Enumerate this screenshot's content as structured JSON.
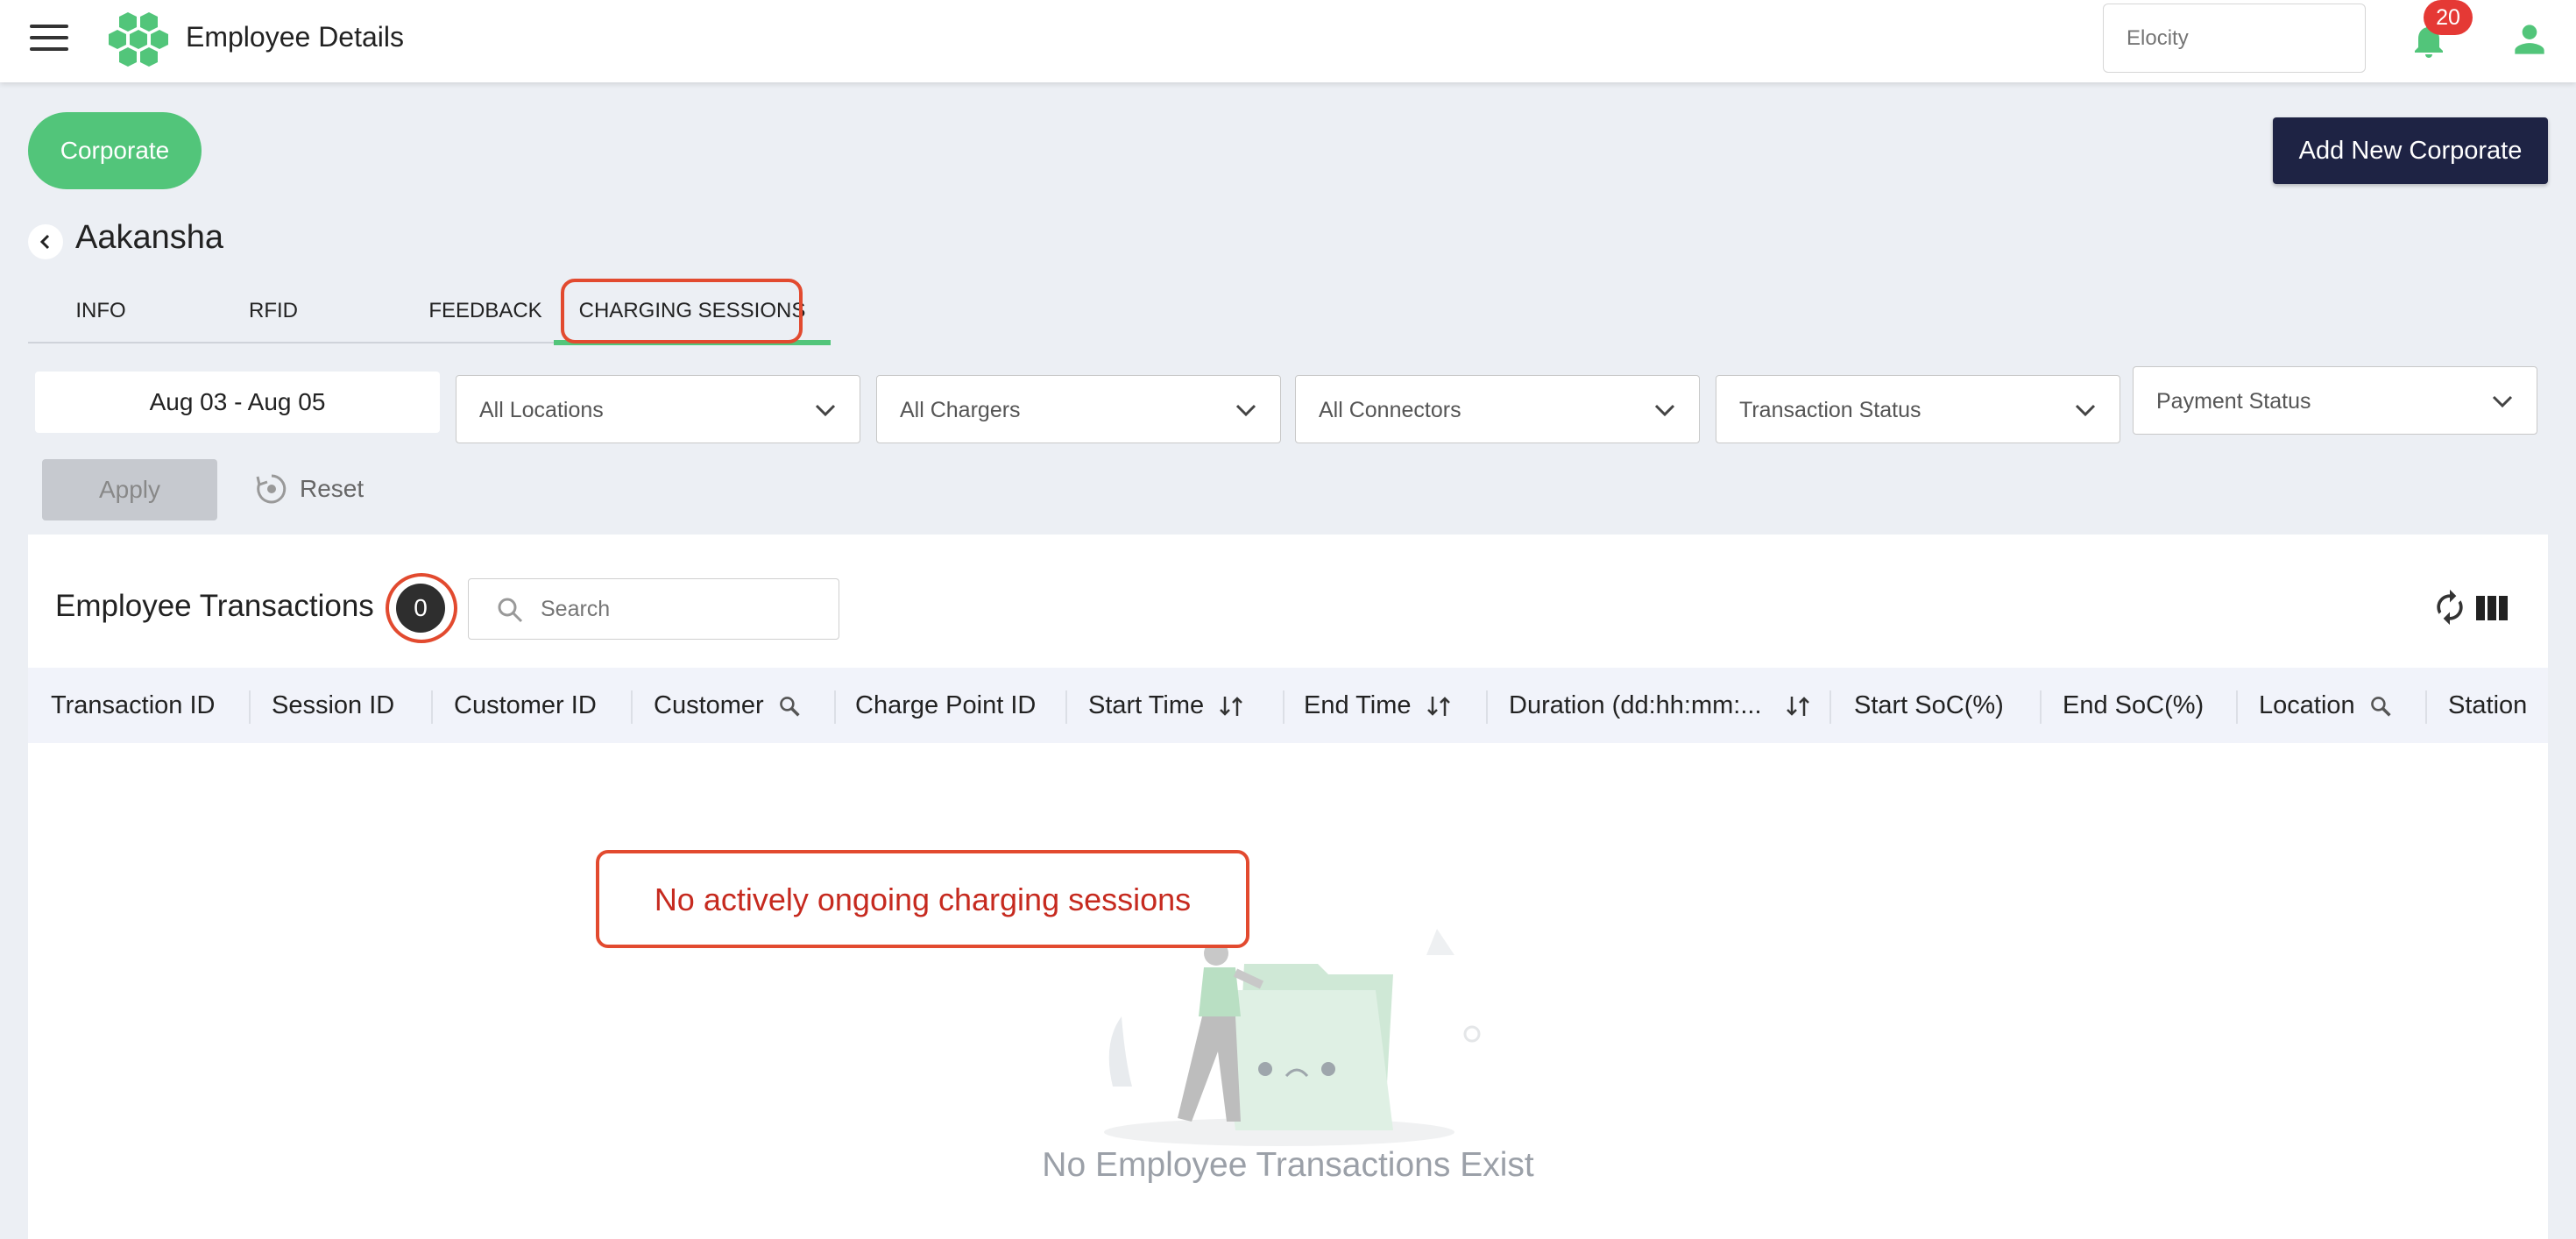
{
  "app": {
    "title": "Employee Details",
    "org_placeholder": "Elocity",
    "notification_count": "20",
    "colors": {
      "brand_green": "#52c57a",
      "dark_navy": "#1e2344",
      "annotation_red": "#e24a2f"
    }
  },
  "header": {
    "corporate_label": "Corporate",
    "add_button_label": "Add New Corporate",
    "employee_name": "Aakansha"
  },
  "tabs": [
    {
      "label": "INFO"
    },
    {
      "label": "RFID"
    },
    {
      "label": "FEEDBACK"
    },
    {
      "label": "CHARGING SESSIONS",
      "active": true
    }
  ],
  "filters": {
    "date_range": "Aug 03 - Aug 05",
    "locations": "All Locations",
    "chargers": "All Chargers",
    "connectors": "All Connectors",
    "transaction_status": "Transaction Status",
    "payment_status": "Payment Status",
    "apply_label": "Apply",
    "reset_label": "Reset"
  },
  "table": {
    "title": "Employee Transactions",
    "count": "0",
    "search_placeholder": "Search",
    "columns": [
      "Transaction ID",
      "Session ID",
      "Customer ID",
      "Customer",
      "Charge Point ID",
      "Start Time",
      "End Time",
      "Duration (dd:hh:mm:...",
      "Start SoC(%)",
      "End SoC(%)",
      "Location",
      "Station"
    ],
    "empty_message": "No Employee Transactions Exist"
  },
  "annotation": {
    "note": "No actively ongoing charging sessions"
  }
}
